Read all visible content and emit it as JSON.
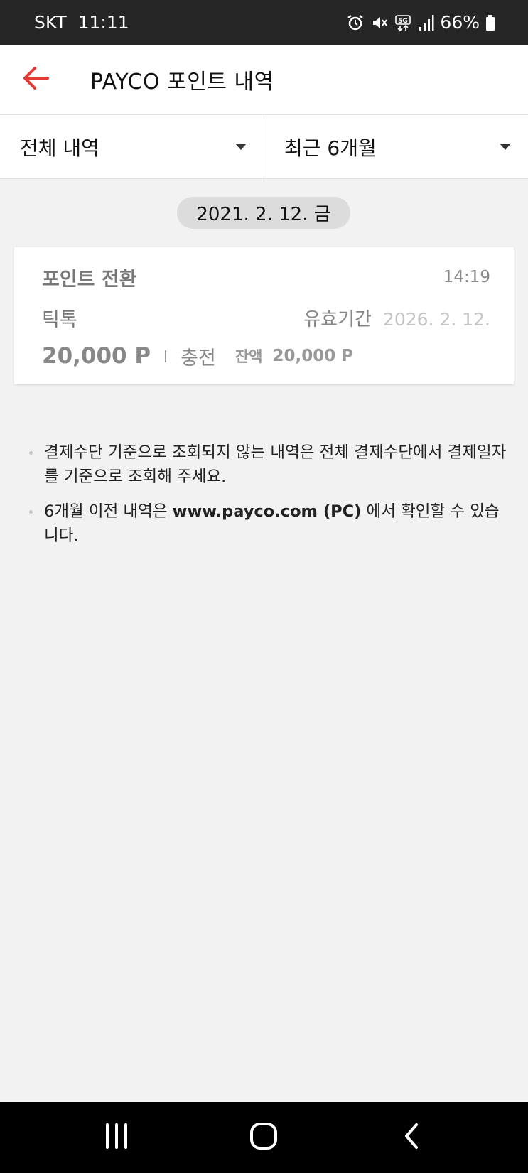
{
  "status_bar": {
    "carrier": "SKT",
    "time": "11:11",
    "network": "5G",
    "battery": "66%",
    "icons": [
      "alarm-icon",
      "mute-icon",
      "5g-icon",
      "signal-icon",
      "battery-icon"
    ]
  },
  "header": {
    "back_icon": "arrow-left-icon",
    "title": "PAYCO 포인트 내역",
    "accent_color": "#e53935"
  },
  "filters": {
    "type": {
      "selected": "전체 내역"
    },
    "period": {
      "selected": "최근 6개월"
    }
  },
  "history": [
    {
      "date": "2021. 2. 12. 금",
      "items": [
        {
          "type": "포인트 전환",
          "time": "14:19",
          "merchant": "틱톡",
          "expiry_label": "유효기간",
          "expiry_date": "2026. 2. 12.",
          "amount": "20,000 P",
          "kind": "충전",
          "balance_label": "잔액",
          "balance": "20,000 P"
        }
      ]
    }
  ],
  "notices": {
    "line1": "결제수단 기준으로 조회되지 않는 내역은 전체 결제수단에서 결제일자를 기준으로 조회해 주세요.",
    "line2_pre": "6개월 이전 내역은 ",
    "line2_link": "www.payco.com (PC)",
    "line2_post": " 에서 확인할 수 있습니다."
  },
  "nav": {
    "recents_icon": "recents-icon",
    "home_icon": "home-icon",
    "back_icon": "back-icon"
  }
}
